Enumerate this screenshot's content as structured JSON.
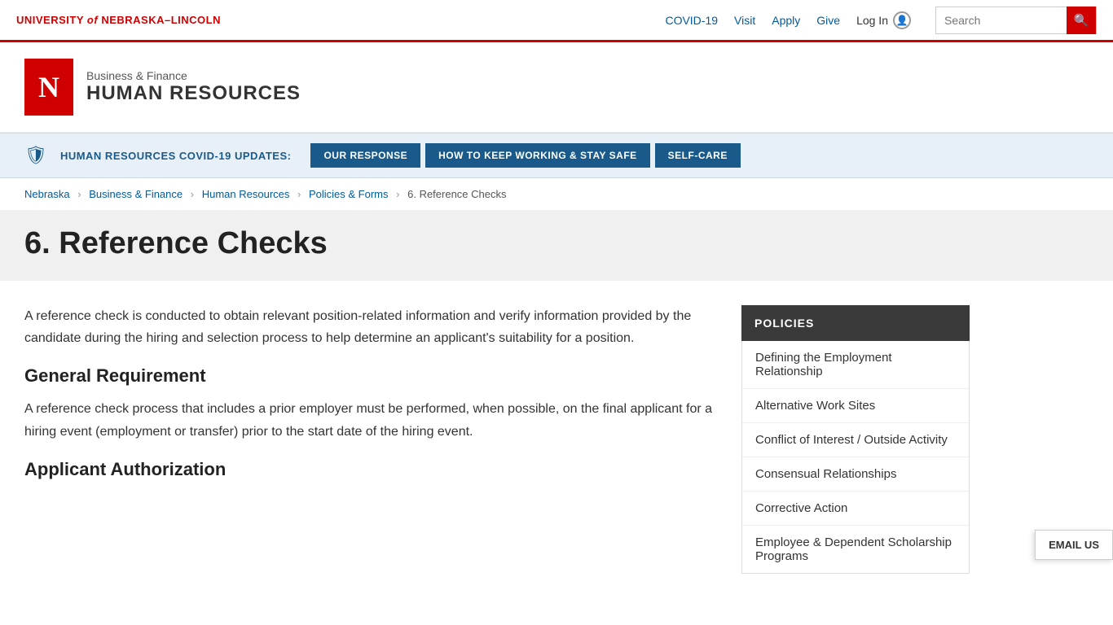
{
  "topbar": {
    "logo_text": "UNIVERSITY",
    "logo_of": "of",
    "logo_university": "NEBRASKA–LINCOLN",
    "nav_links": [
      {
        "label": "COVID-19",
        "id": "covid19"
      },
      {
        "label": "Visit",
        "id": "visit"
      },
      {
        "label": "Apply",
        "id": "apply"
      },
      {
        "label": "Give",
        "id": "give"
      }
    ],
    "login_label": "Log In",
    "search_placeholder": "Search",
    "search_button_icon": "🔍"
  },
  "header": {
    "logo_letter": "N",
    "subtitle": "Business & Finance",
    "title": "HUMAN RESOURCES"
  },
  "covid_banner": {
    "icon": "🛡",
    "label": "HUMAN RESOURCES COVID-19 UPDATES:",
    "buttons": [
      {
        "label": "OUR RESPONSE"
      },
      {
        "label": "HOW TO KEEP WORKING & STAY SAFE"
      },
      {
        "label": "SELF-CARE"
      }
    ]
  },
  "breadcrumb": {
    "items": [
      {
        "label": "Nebraska",
        "link": true
      },
      {
        "label": "Business & Finance",
        "link": true
      },
      {
        "label": "Human Resources",
        "link": true
      },
      {
        "label": "Policies & Forms",
        "link": true
      },
      {
        "label": "6. Reference Checks",
        "link": false
      }
    ]
  },
  "page_title": "6. Reference Checks",
  "content": {
    "intro": "A reference check is conducted to obtain relevant position-related information and verify information provided by the candidate during the hiring and selection process to help determine an applicant's suitability for a position.",
    "section1_title": "General Requirement",
    "section1_body": "A reference check process that includes a prior employer must be performed, when possible, on the final applicant for a hiring event (employment or transfer) prior to the start date of the hiring event.",
    "section2_title": "Applicant Authorization"
  },
  "sidebar": {
    "header": "POLICIES",
    "items": [
      {
        "label": "Defining the Employment Relationship"
      },
      {
        "label": "Alternative Work Sites"
      },
      {
        "label": "Conflict of Interest / Outside Activity"
      },
      {
        "label": "Consensual Relationships"
      },
      {
        "label": "Corrective Action"
      },
      {
        "label": "Employee & Dependent Scholarship Programs"
      }
    ]
  },
  "email_us_btn": "EMAIL US"
}
